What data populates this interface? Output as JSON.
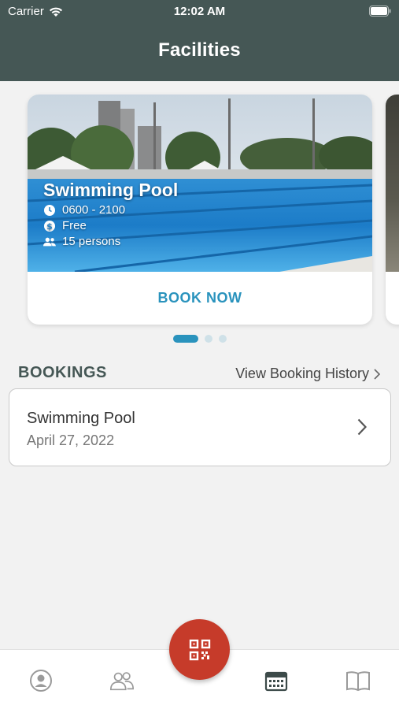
{
  "status_bar": {
    "carrier": "Carrier",
    "time": "12:02 AM",
    "wifi_icon": "wifi-icon",
    "battery_icon": "battery-icon"
  },
  "header": {
    "title": "Facilities",
    "background_color": "#455755"
  },
  "carousel": {
    "cards": [
      {
        "title": "Swimming Pool",
        "hours": "0600 - 2100",
        "price": "Free",
        "capacity": "15 persons",
        "action_label": "BOOK NOW"
      }
    ],
    "active_index": 0,
    "dot_count": 3
  },
  "bookings": {
    "title": "BOOKINGS",
    "history_link": "View Booking History",
    "items": [
      {
        "name": "Swimming Pool",
        "date": "April 27, 2022"
      }
    ]
  },
  "bottom_nav": {
    "items": [
      "profile-icon",
      "people-icon",
      "calendar-icon",
      "book-icon"
    ],
    "active": "calendar-icon",
    "center_button_icon": "qr-code-icon",
    "center_button_color": "#c63b2a"
  },
  "colors": {
    "accent": "#2a93bd",
    "primary_dark": "#455755"
  }
}
